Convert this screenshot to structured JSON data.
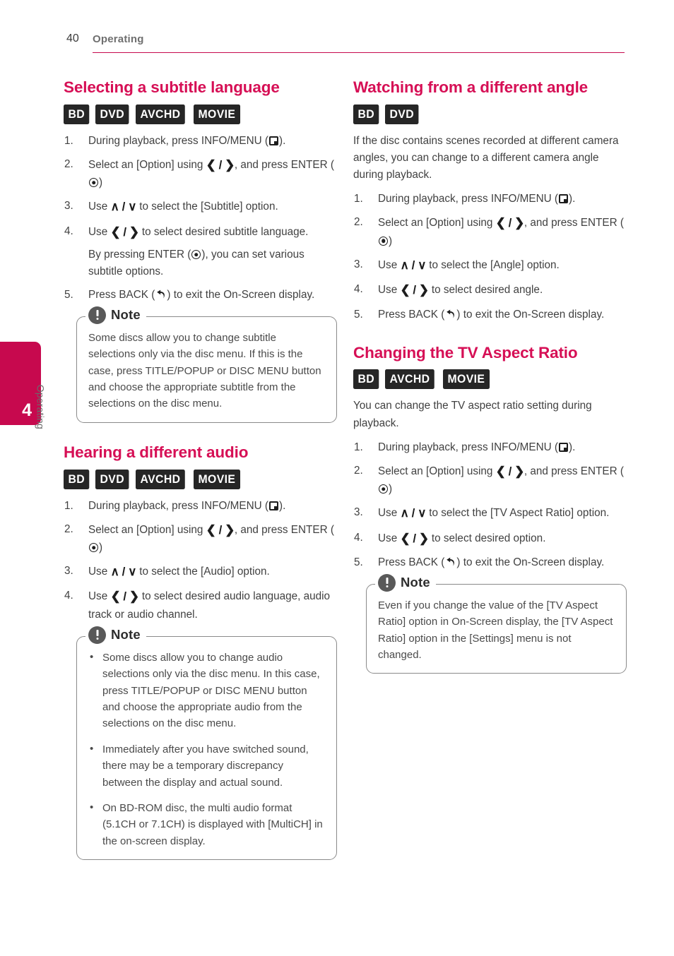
{
  "header": {
    "page_number": "40",
    "title": "Operating",
    "rule_color": "#c7094e"
  },
  "side_tab": {
    "number": "4",
    "label": "Operating",
    "color": "#c7094e"
  },
  "theme": {
    "heading_color": "#d60f55",
    "badge_bg": "#262626",
    "note_icon_bg": "#595959",
    "body_text": "#414141"
  },
  "left_column": {
    "sections": [
      {
        "title": "Selecting a subtitle language",
        "badges": [
          "BD",
          "DVD",
          "AVCHD",
          "MOVIE"
        ],
        "steps": [
          {
            "pre": "During playback, press INFO/MENU (",
            "icon": "info-menu-icon",
            "post": ")."
          },
          {
            "pre": "Select an [Option] using ",
            "arrows": "❮ / ❯",
            "post": ", and press ENTER (",
            "icon2": "enter-icon",
            "tail": ")"
          },
          {
            "pre": "Use ",
            "arrows": "∧ / ∨",
            "post": " to select the [Subtitle] option."
          },
          {
            "pre": "Use ",
            "arrows": "❮ / ❯",
            "post": " to select desired subtitle language.",
            "sub_pre": "By pressing ENTER (",
            "sub_icon": "enter-icon",
            "sub_post": "), you can set various subtitle options."
          },
          {
            "pre": "Press BACK (",
            "icon": "back-icon",
            "post": ") to exit the On-Screen display."
          }
        ],
        "note": {
          "title": "Note",
          "paragraphs": [
            "Some discs allow you to change subtitle selections only via the disc menu. If this is the case, press TITLE/POPUP or DISC MENU button and choose the appropriate subtitle from the selections on the disc menu."
          ]
        }
      },
      {
        "title": "Hearing a different audio",
        "badges": [
          "BD",
          "DVD",
          "AVCHD",
          "MOVIE"
        ],
        "steps": [
          {
            "pre": "During playback, press INFO/MENU (",
            "icon": "info-menu-icon",
            "post": ")."
          },
          {
            "pre": "Select an [Option] using ",
            "arrows": "❮ / ❯",
            "post": ", and press ENTER (",
            "icon2": "enter-icon",
            "tail": ")"
          },
          {
            "pre": "Use ",
            "arrows": "∧ / ∨",
            "post": " to select the [Audio] option."
          },
          {
            "pre": "Use ",
            "arrows": "❮ / ❯",
            "post": " to select desired audio language, audio track or audio channel."
          }
        ],
        "note": {
          "title": "Note",
          "bullets": [
            "Some discs allow you to change audio selections only via the disc menu. In this case, press TITLE/POPUP or DISC MENU button and choose the appropriate audio from the selections on the disc menu.",
            "Immediately after you have switched sound, there may be a temporary discrepancy between the display and actual sound.",
            "On BD-ROM disc, the multi audio format (5.1CH or 7.1CH) is displayed with [MultiCH] in the on-screen display."
          ]
        }
      }
    ]
  },
  "right_column": {
    "sections": [
      {
        "title": "Watching from a different angle",
        "badges": [
          "BD",
          "DVD"
        ],
        "intro": "If the disc contains scenes recorded at different camera angles, you can change to a different camera angle during playback.",
        "steps": [
          {
            "pre": "During playback, press INFO/MENU (",
            "icon": "info-menu-icon",
            "post": ")."
          },
          {
            "pre": "Select an [Option] using ",
            "arrows": "❮ / ❯",
            "post": ", and press ENTER (",
            "icon2": "enter-icon",
            "tail": ")"
          },
          {
            "pre": "Use ",
            "arrows": "∧ / ∨",
            "post": " to select the [Angle] option."
          },
          {
            "pre": "Use ",
            "arrows": "❮ / ❯",
            "post": " to select desired angle."
          },
          {
            "pre": "Press BACK (",
            "icon": "back-icon",
            "post": ") to exit the On-Screen display."
          }
        ]
      },
      {
        "title": "Changing the TV Aspect Ratio",
        "badges": [
          "BD",
          "AVCHD",
          "MOVIE"
        ],
        "intro": "You can change the TV aspect ratio setting during playback.",
        "steps": [
          {
            "pre": "During playback, press INFO/MENU (",
            "icon": "info-menu-icon",
            "post": ")."
          },
          {
            "pre": "Select an [Option] using ",
            "arrows": "❮ / ❯",
            "post": ", and press ENTER (",
            "icon2": "enter-icon",
            "tail": ")"
          },
          {
            "pre": "Use ",
            "arrows": "∧ / ∨",
            "post": " to select the [TV Aspect Ratio] option."
          },
          {
            "pre": "Use ",
            "arrows": "❮ / ❯",
            "post": " to select desired option."
          },
          {
            "pre": "Press BACK (",
            "icon": "back-icon",
            "post": ") to exit the On-Screen display."
          }
        ],
        "note": {
          "title": "Note",
          "paragraphs": [
            "Even if you change the value of the [TV Aspect Ratio] option in On-Screen display, the [TV Aspect Ratio] option in the [Settings] menu is not changed."
          ]
        }
      }
    ]
  }
}
